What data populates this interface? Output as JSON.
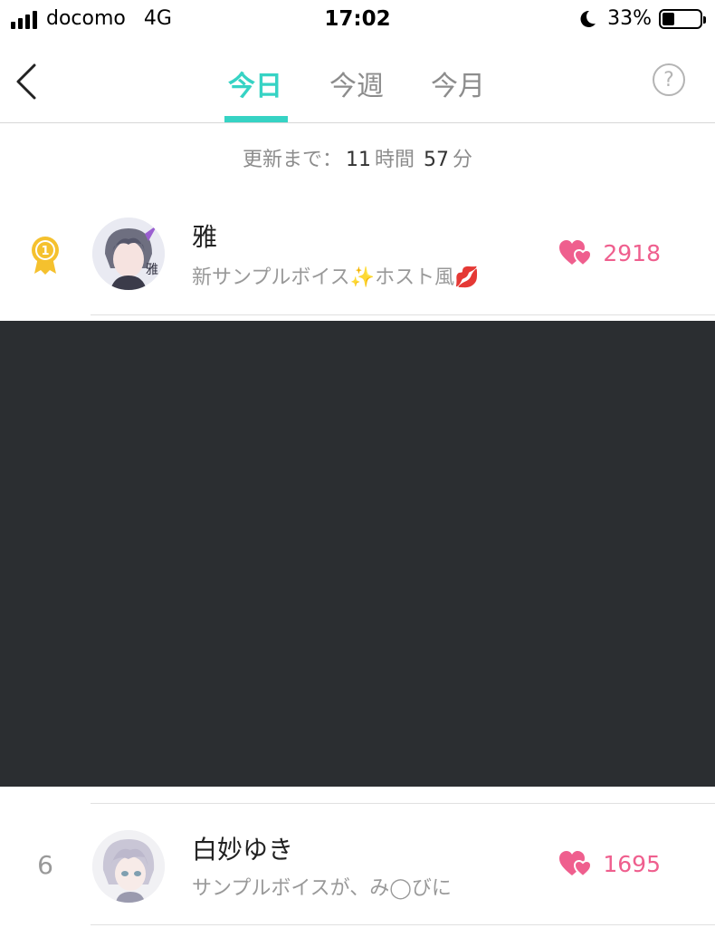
{
  "status_bar": {
    "carrier": "docomo",
    "network": "4G",
    "time": "17:02",
    "battery_percent": "33%"
  },
  "nav": {
    "tabs": [
      {
        "label": "今日",
        "active": true
      },
      {
        "label": "今週",
        "active": false
      },
      {
        "label": "今月",
        "active": false
      }
    ],
    "help_icon": "?"
  },
  "countdown": {
    "prefix": "更新まで：",
    "hours": "11",
    "hours_unit": "時間",
    "minutes": "57",
    "minutes_unit": "分"
  },
  "ranking": [
    {
      "rank": "1",
      "rank_display": "medal",
      "name": "雅",
      "description": "新サンプルボイス✨ホスト風💋",
      "likes": "2918",
      "avatar_badge": "雅"
    },
    {
      "rank": "6",
      "rank_display": "number",
      "name": "白妙ゆき",
      "description": "サンプルボイスが、み◯びに",
      "likes": "1695"
    }
  ],
  "colors": {
    "accent": "#36d3c4",
    "heart": "#ef5f8e",
    "medal": "#f5c12e",
    "redacted": "#2b2e31"
  }
}
